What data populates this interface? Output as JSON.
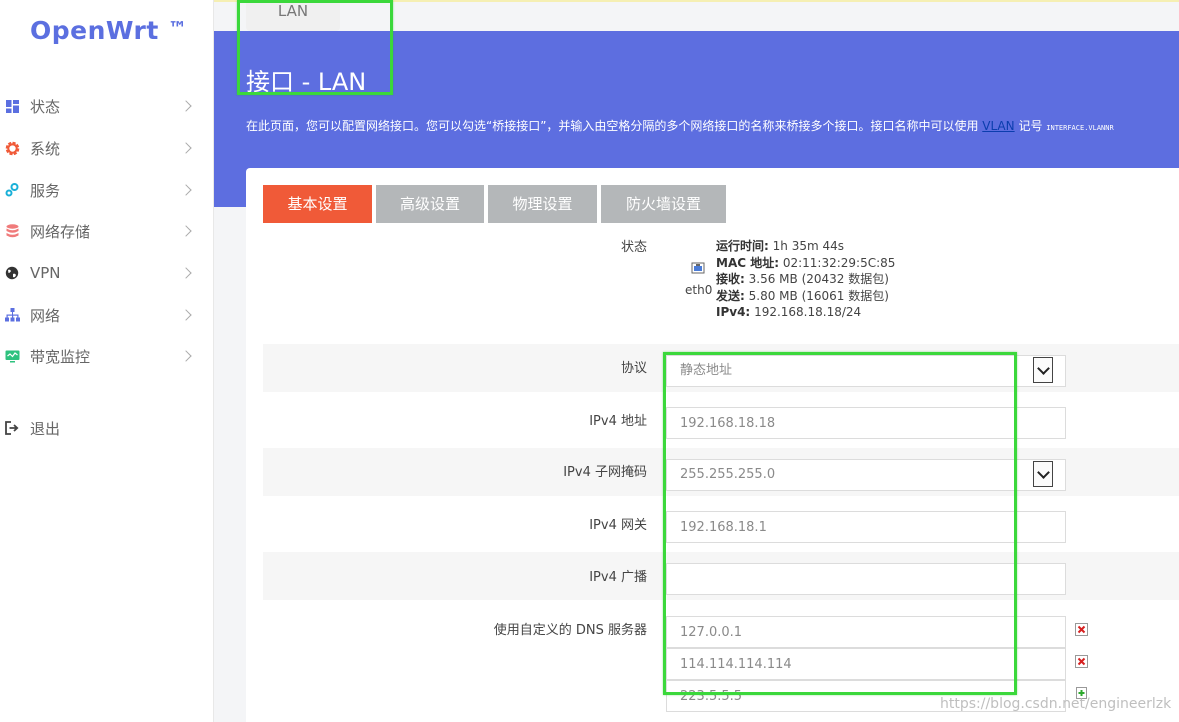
{
  "brand": {
    "logo_text": "OpenWrt",
    "logo_tm": "™"
  },
  "sidebar": {
    "items": [
      {
        "label": "状态",
        "icon": "dashboard-icon",
        "color": "#5b6fe0"
      },
      {
        "label": "系统",
        "icon": "gear-icon",
        "color": "#f05a38"
      },
      {
        "label": "服务",
        "icon": "services-icon",
        "color": "#1ab0d8"
      },
      {
        "label": "网络存储",
        "icon": "database-icon",
        "color": "#f07b7b"
      },
      {
        "label": "VPN",
        "icon": "globe-icon",
        "color": "#333333"
      },
      {
        "label": "网络",
        "icon": "network-icon",
        "color": "#5b6fe0"
      },
      {
        "label": "带宽监控",
        "icon": "monitor-icon",
        "color": "#2ec27e"
      }
    ],
    "logout_label": "退出"
  },
  "top_tab": {
    "label": "LAN"
  },
  "header": {
    "title": "接口 - LAN",
    "desc_main": "在此页面，您可以配置网络接口。您可以勾选“桥接接口”，并输入由空格分隔的多个网络接口的名称来桥接多个接口。接口名称中可以使用 ",
    "desc_link": "VLAN",
    "desc_after": " 记号 ",
    "desc_mono": "INTERFACE.VLANNR"
  },
  "tabs": [
    {
      "label": "基本设置",
      "active": true
    },
    {
      "label": "高级设置",
      "active": false
    },
    {
      "label": "物理设置",
      "active": false
    },
    {
      "label": "防火墙设置",
      "active": false
    }
  ],
  "status": {
    "label": "状态",
    "device": "eth0",
    "uptime_label": "运行时间:",
    "uptime": "1h 35m 44s",
    "mac_label": "MAC 地址:",
    "mac": "02:11:32:29:5C:85",
    "rx_label": "接收:",
    "rx": "3.56 MB (20432 数据包)",
    "tx_label": "发送:",
    "tx": "5.80 MB (16061 数据包)",
    "ipv4_label": "IPv4:",
    "ipv4": "192.168.18.18/24"
  },
  "form": {
    "protocol_label": "协议",
    "protocol_value": "静态地址",
    "ipv4_addr_label": "IPv4 地址",
    "ipv4_addr_value": "192.168.18.18",
    "netmask_label": "IPv4 子网掩码",
    "netmask_value": "255.255.255.0",
    "gateway_label": "IPv4 网关",
    "gateway_value": "192.168.18.1",
    "broadcast_label": "IPv4 广播",
    "broadcast_value": "",
    "dns_label": "使用自定义的 DNS 服务器",
    "dns_values": [
      "127.0.0.1",
      "114.114.114.114",
      "223.5.5.5"
    ]
  },
  "watermark": "https://blog.csdn.net/engineerlzk",
  "colors": {
    "accent": "#5d6ee0",
    "active_tab": "#f05a38",
    "inactive_tab": "#b4b7b9",
    "highlight": "#3bd83b"
  }
}
